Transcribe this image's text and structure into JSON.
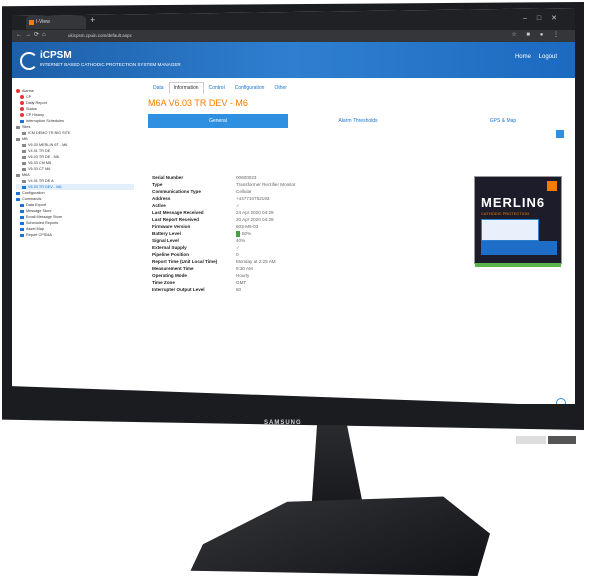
{
  "browser": {
    "tab_title": "I-View",
    "url": "ukicpsm.cpuin.com/default.aspx"
  },
  "app": {
    "name": "iCPSM",
    "tagline": "INTERNET BASED CATHODIC PROTECTION SYSTEM MANAGER",
    "nav": [
      "Home",
      "Logout"
    ]
  },
  "sidebar": {
    "items": [
      "Alarms",
      "CP",
      "Daily Report",
      "Status",
      "CP History",
      "Interruption Schedules",
      "Sites",
      "ICM DEMO TR BIG SITE",
      "MB",
      "V6.03 MERLIN 6T - M6",
      "V4.01 TR DE",
      "V6.03 TR DE - M6",
      "V6.03 CM M6",
      "V6.03 CT M6",
      "M6A",
      "V4.01 TR DE A",
      "V6.03 TR DEV - M6",
      "Configuration",
      "Commands",
      "Data Export",
      "Message Store",
      "Email Message Store",
      "Scheduled Reports",
      "Asset Map",
      "Report CPSMA"
    ]
  },
  "content": {
    "tabs": [
      "Data",
      "Information",
      "Control",
      "Configuration",
      "Other"
    ],
    "device_title": "M6A V6.03 TR DEV - M6",
    "subtabs": [
      "General",
      "Alarm Thresholds",
      "GPS & Map"
    ],
    "details": [
      {
        "label": "Serial Number",
        "value": "00600023"
      },
      {
        "label": "Type",
        "value": "Transformer Rectifier Monitor"
      },
      {
        "label": "Communications Type",
        "value": "Cellular"
      },
      {
        "label": "Address",
        "value": "+447710752193"
      },
      {
        "label": "Active",
        "value": "✓"
      },
      {
        "label": "Last Message Received",
        "value": "24 Apr 2020 04:29"
      },
      {
        "label": "Last Report Received",
        "value": "20 Apr 2020 04:29"
      },
      {
        "label": "Firmware Version",
        "value": "603-M6-03"
      },
      {
        "label": "Battery Level",
        "value": "50%"
      },
      {
        "label": "Signal Level",
        "value": "40%"
      },
      {
        "label": "External Supply",
        "value": "✓"
      },
      {
        "label": "Pipeline Position",
        "value": "0"
      },
      {
        "label": "Report Time (Unit Local Time)",
        "value": "Monday at 2:25 AM"
      },
      {
        "label": "Measurement Time",
        "value": "9:30 AM"
      },
      {
        "label": "Operating Mode",
        "value": "Hourly"
      },
      {
        "label": "Time Zone",
        "value": "GMT"
      },
      {
        "label": "Interrupter Output Level",
        "value": "60"
      }
    ],
    "product_name": "MERLIN6",
    "product_sub": "CATHODIC PROTECTION"
  },
  "monitor": {
    "brand": "SAMSUNG"
  },
  "colors": {
    "header_blue": "#2f7fd1",
    "title_orange": "#f57c00",
    "active_tab_blue": "#2f8fe0",
    "ok_green": "#43a047"
  }
}
